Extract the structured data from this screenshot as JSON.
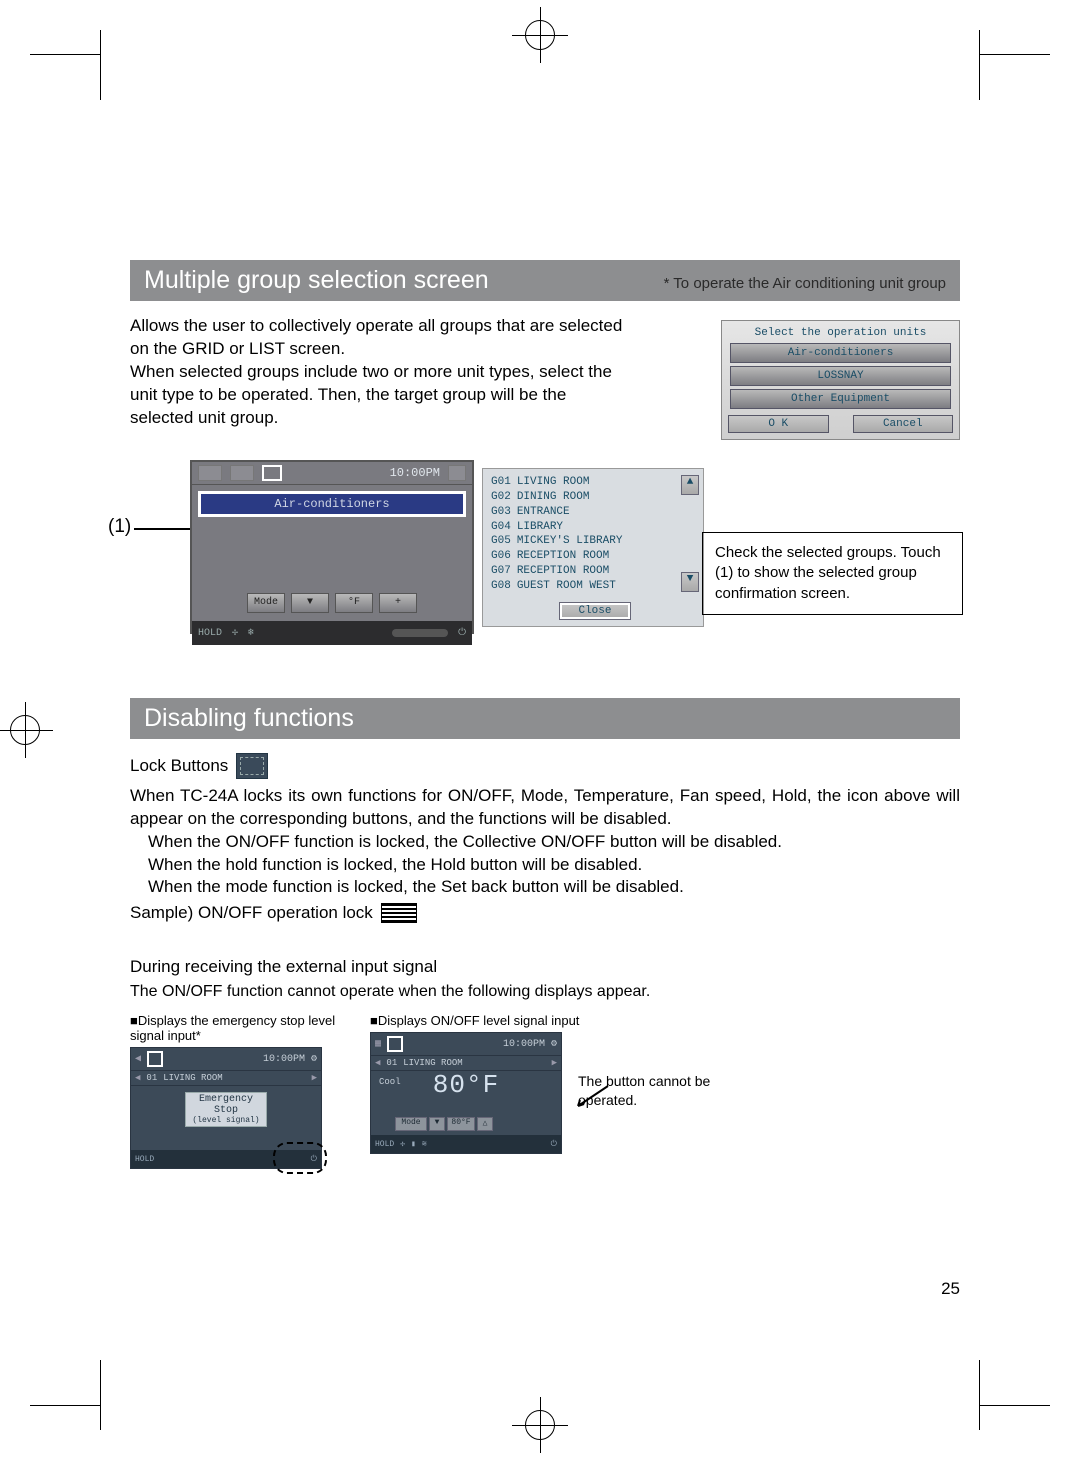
{
  "page_number": "25",
  "section1": {
    "title": "Multiple group selection screen",
    "subtitle": "* To operate the Air conditioning unit group",
    "para": "Allows the user to collectively operate all groups that are selected on the GRID or LIST screen.\nWhen selected groups include two or more unit types, select the unit type to be operated. Then, the target group will be the selected unit group.",
    "callout_label": "(1)",
    "note": "Check the selected groups. Touch (1) to show the selected group confirmation screen."
  },
  "sel_popup": {
    "header": "Select the operation units",
    "options": [
      "Air-conditioners",
      "LOSSNAY",
      "Other Equipment"
    ],
    "ok": "O  K",
    "cancel": "Cancel"
  },
  "lcd": {
    "time": "10:00PM",
    "bluebar": "Air-conditioners",
    "mode_btn": "Mode",
    "down": "▼",
    "deg": "°F",
    "up": "+",
    "hold": "HOLD"
  },
  "groups": [
    {
      "id": "G01",
      "name": "LIVING ROOM"
    },
    {
      "id": "G02",
      "name": "DINING ROOM"
    },
    {
      "id": "G03",
      "name": "ENTRANCE"
    },
    {
      "id": "G04",
      "name": "LIBRARY"
    },
    {
      "id": "G05",
      "name": "MICKEY'S LIBRARY"
    },
    {
      "id": "G06",
      "name": "RECEPTION ROOM"
    },
    {
      "id": "G07",
      "name": "RECEPTION ROOM"
    },
    {
      "id": "G08",
      "name": "GUEST ROOM WEST"
    }
  ],
  "close": "Close",
  "section2": {
    "title": "Disabling functions",
    "lock_buttons": "Lock Buttons",
    "body": "When TC-24A locks its own functions for ON/OFF, Mode, Temperature, Fan speed, Hold, the icon above will appear on the corresponding buttons, and the functions will be disabled.",
    "l1": "When the ON/OFF function is locked, the Collective ON/OFF button will be disabled.",
    "l2": "When the hold function is locked, the Hold button will be disabled.",
    "l3": "When the mode function is locked, the Set back button will be disabled.",
    "sample": "Sample) ON/OFF operation lock"
  },
  "section3": {
    "heading": "During receiving the external input signal",
    "para": "The ON/OFF function cannot operate when the following displays appear.",
    "fig1_cap": "■Displays the emergency stop level signal input*",
    "fig2_cap": "■Displays ON/OFF level signal input",
    "button_note": "The button cannot be operated."
  },
  "mini": {
    "time": "10:00PM",
    "room_id": "01",
    "room": "LIVING ROOM",
    "emergency1": "Emergency Stop",
    "emergency2": "(level signal)",
    "hold": "HOLD",
    "cool": "Cool",
    "temp": "80°F",
    "set": "80°F",
    "mode": "Mode",
    "down": "▼",
    "up": "△"
  }
}
